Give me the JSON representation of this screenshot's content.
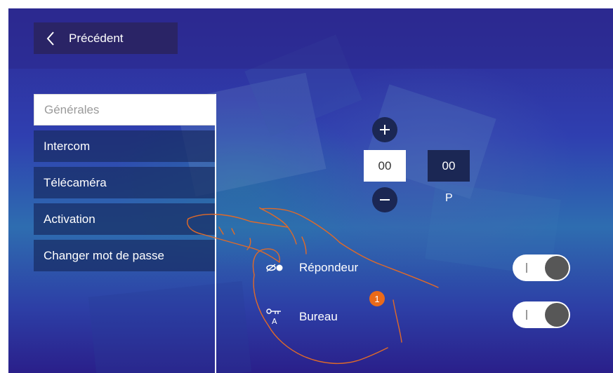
{
  "header": {
    "back_label": "Précédent"
  },
  "menu": {
    "items": [
      {
        "label": "Générales",
        "active": true
      },
      {
        "label": "Intercom",
        "active": false
      },
      {
        "label": "Télécaméra",
        "active": false
      },
      {
        "label": "Activation",
        "active": false
      },
      {
        "label": "Changer mot de passe",
        "active": false
      }
    ]
  },
  "code": {
    "value_left": "00",
    "value_right": "00",
    "label": "P"
  },
  "options": [
    {
      "label": "Répondeur",
      "icon": "answering-machine-icon",
      "toggle_state": "on"
    },
    {
      "label": "Bureau",
      "icon": "office-key-icon",
      "toggle_state": "on"
    }
  ],
  "callout": {
    "number": "1"
  },
  "colors": {
    "accent": "#ea6a1a",
    "panel": "#1b2754",
    "back_button": "#2a2466"
  }
}
